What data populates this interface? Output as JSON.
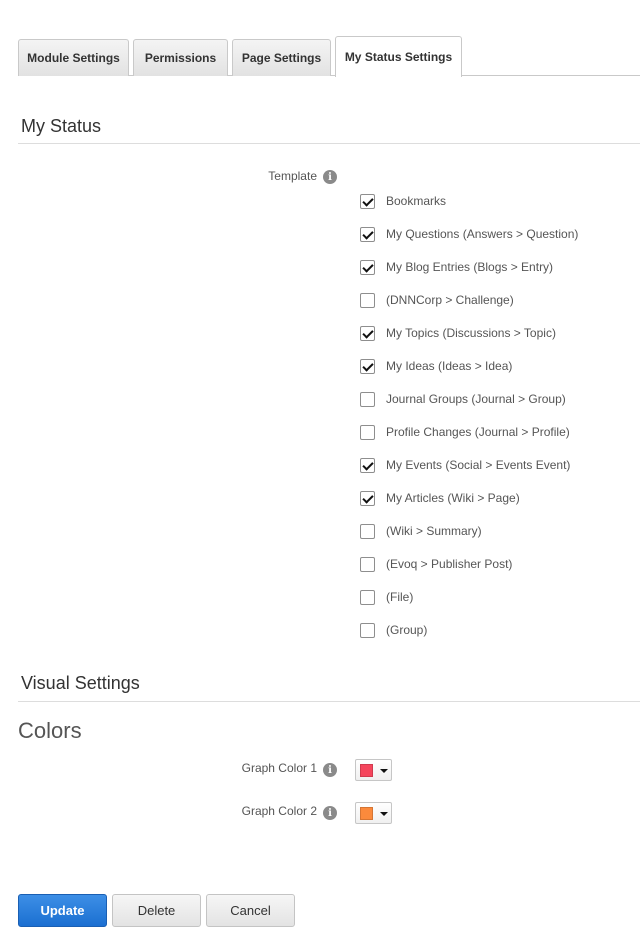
{
  "tabs": [
    {
      "label": "Module Settings",
      "active": false
    },
    {
      "label": "Permissions",
      "active": false
    },
    {
      "label": "Page Settings",
      "active": false
    },
    {
      "label": "My Status Settings",
      "active": true
    }
  ],
  "my_status": {
    "title": "My Status",
    "template_label": "Template",
    "info_icon": "i",
    "templates": [
      {
        "label": "Bookmarks",
        "checked": true
      },
      {
        "label": "My Questions (Answers > Question)",
        "checked": true
      },
      {
        "label": "My Blog Entries (Blogs > Entry)",
        "checked": true
      },
      {
        "label": "(DNNCorp > Challenge)",
        "checked": false
      },
      {
        "label": "My Topics (Discussions > Topic)",
        "checked": true
      },
      {
        "label": "My Ideas (Ideas > Idea)",
        "checked": true
      },
      {
        "label": "Journal Groups (Journal > Group)",
        "checked": false
      },
      {
        "label": "Profile Changes (Journal > Profile)",
        "checked": false
      },
      {
        "label": "My Events (Social > Events Event)",
        "checked": true
      },
      {
        "label": "My Articles (Wiki > Page)",
        "checked": true
      },
      {
        "label": "(Wiki > Summary)",
        "checked": false
      },
      {
        "label": "(Evoq > Publisher Post)",
        "checked": false
      },
      {
        "label": "(File)",
        "checked": false
      },
      {
        "label": "(Group)",
        "checked": false
      }
    ]
  },
  "visual_settings": {
    "title": "Visual Settings",
    "colors_title": "Colors",
    "graph_colors": [
      {
        "label": "Graph Color 1",
        "value": "#f5455c"
      },
      {
        "label": "Graph Color 2",
        "value": "#fb8a3c"
      }
    ]
  },
  "actions": {
    "update": "Update",
    "delete": "Delete",
    "cancel": "Cancel"
  }
}
